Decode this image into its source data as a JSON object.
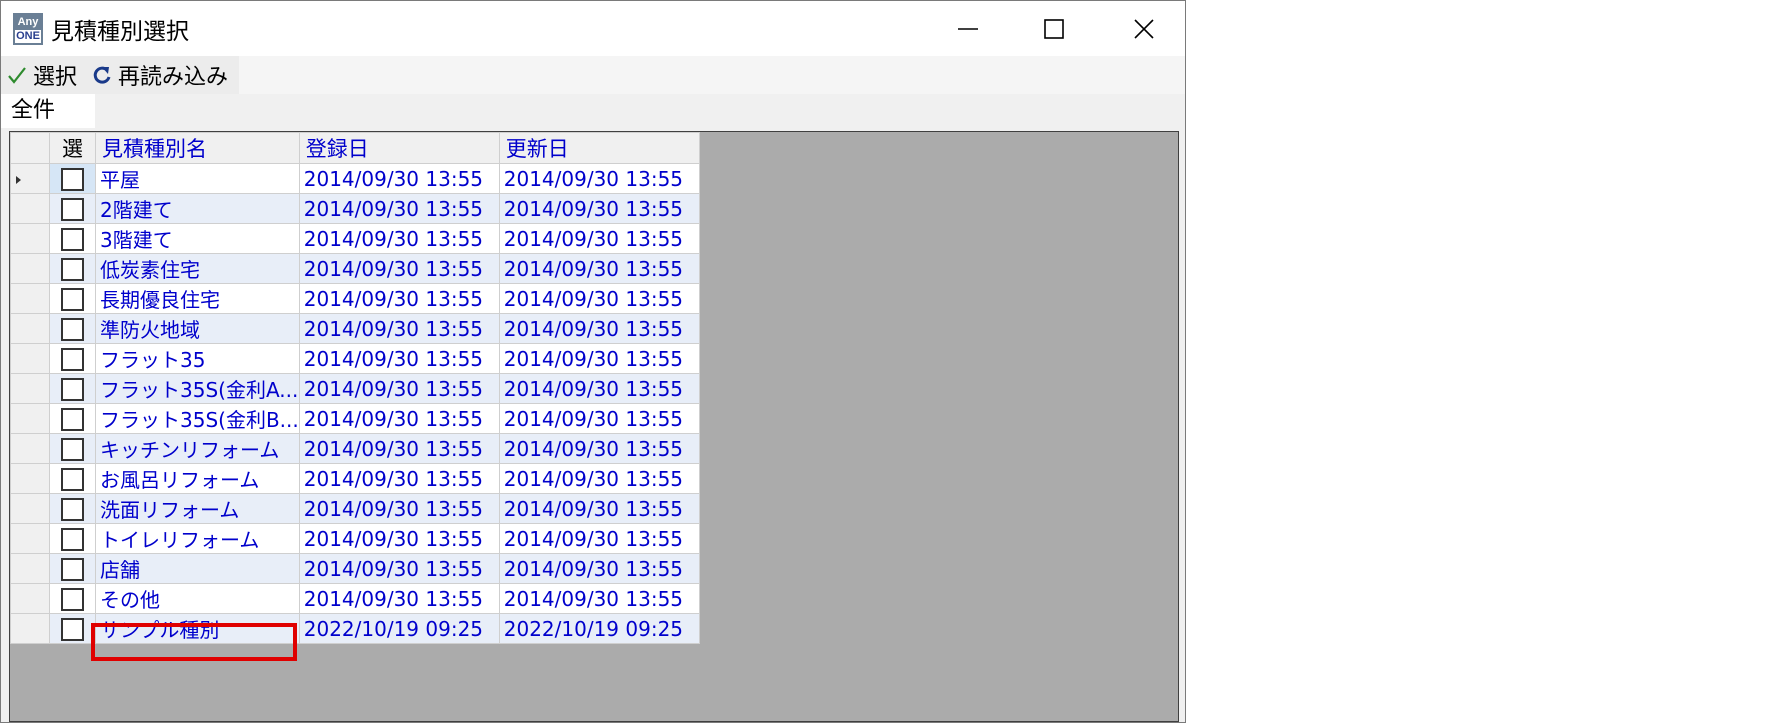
{
  "window": {
    "title": "見積種別選択",
    "app_icon_line1": "Any",
    "app_icon_line2": "ONE",
    "controls": [
      "minimize-icon",
      "maximize-icon",
      "close-icon"
    ]
  },
  "toolbar": {
    "select_label": "選択",
    "reload_label": "再読み込み",
    "select_icon": "checkmark-icon",
    "reload_icon": "refresh-icon"
  },
  "filter": {
    "tab_label": "全件"
  },
  "grid": {
    "columns": {
      "select": "選",
      "name": "見積種別名",
      "registered": "登録日",
      "updated": "更新日"
    },
    "rows": [
      {
        "name": "平屋",
        "registered": "2014/09/30 13:55",
        "updated": "2014/09/30 13:55"
      },
      {
        "name": "2階建て",
        "registered": "2014/09/30 13:55",
        "updated": "2014/09/30 13:55"
      },
      {
        "name": "3階建て",
        "registered": "2014/09/30 13:55",
        "updated": "2014/09/30 13:55"
      },
      {
        "name": "低炭素住宅",
        "registered": "2014/09/30 13:55",
        "updated": "2014/09/30 13:55"
      },
      {
        "name": "長期優良住宅",
        "registered": "2014/09/30 13:55",
        "updated": "2014/09/30 13:55"
      },
      {
        "name": "準防火地域",
        "registered": "2014/09/30 13:55",
        "updated": "2014/09/30 13:55"
      },
      {
        "name": "フラット35",
        "registered": "2014/09/30 13:55",
        "updated": "2014/09/30 13:55"
      },
      {
        "name": "フラット35S(金利A...",
        "registered": "2014/09/30 13:55",
        "updated": "2014/09/30 13:55"
      },
      {
        "name": "フラット35S(金利B...",
        "registered": "2014/09/30 13:55",
        "updated": "2014/09/30 13:55"
      },
      {
        "name": "キッチンリフォーム",
        "registered": "2014/09/30 13:55",
        "updated": "2014/09/30 13:55"
      },
      {
        "name": "お風呂リフォーム",
        "registered": "2014/09/30 13:55",
        "updated": "2014/09/30 13:55"
      },
      {
        "name": "洗面リフォーム",
        "registered": "2014/09/30 13:55",
        "updated": "2014/09/30 13:55"
      },
      {
        "name": "トイレリフォーム",
        "registered": "2014/09/30 13:55",
        "updated": "2014/09/30 13:55"
      },
      {
        "name": "店舗",
        "registered": "2014/09/30 13:55",
        "updated": "2014/09/30 13:55"
      },
      {
        "name": "その他",
        "registered": "2014/09/30 13:55",
        "updated": "2014/09/30 13:55"
      },
      {
        "name": "サンプル種別",
        "registered": "2022/10/19 09:25",
        "updated": "2022/10/19 09:25"
      }
    ]
  },
  "colors": {
    "text_blue": "#0000cc",
    "highlight_red": "#e00000",
    "grid_bg": "#ababab"
  }
}
